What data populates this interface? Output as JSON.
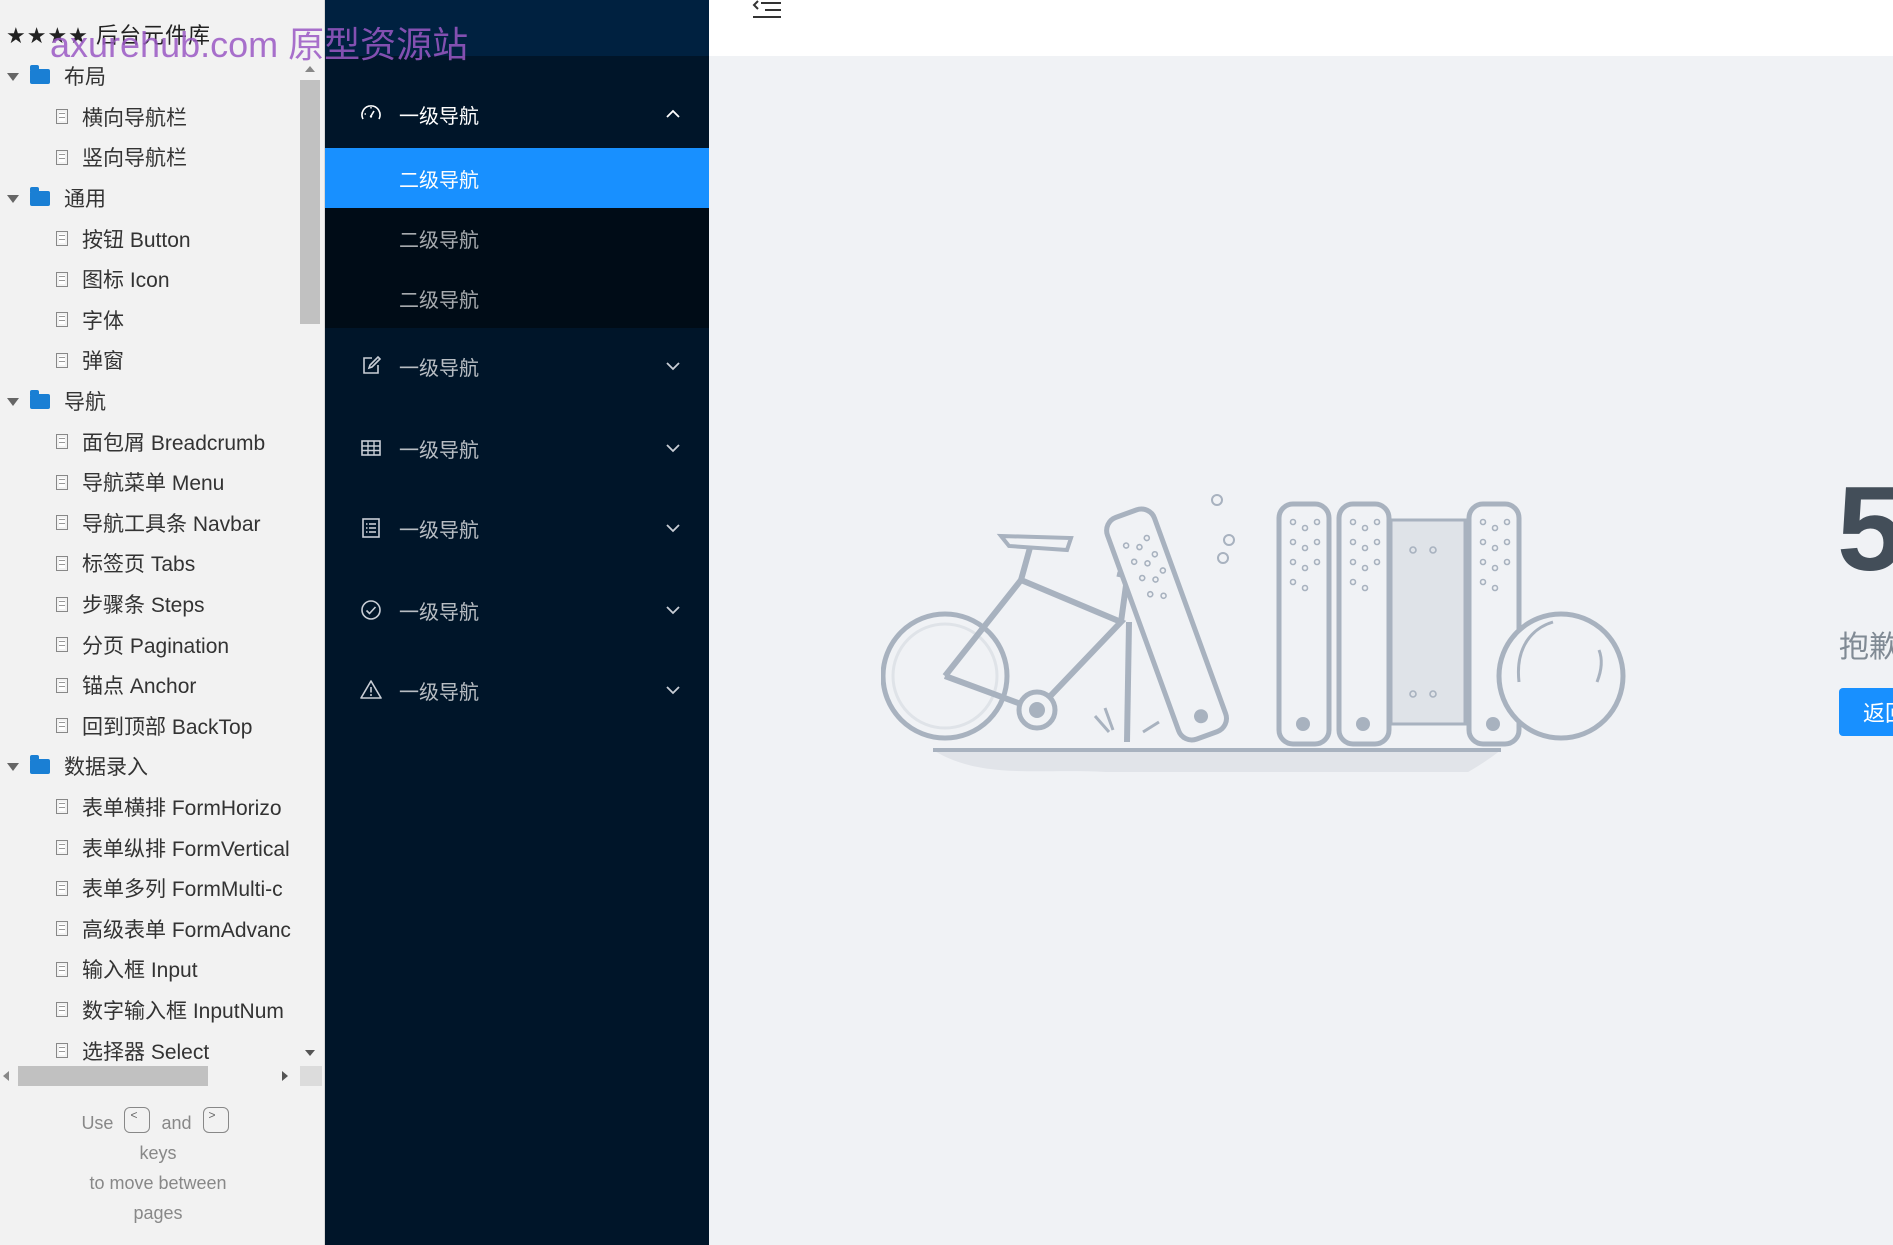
{
  "library": {
    "title": "★★★★ 后台元件库",
    "watermark": "axurehub.com 原型资源站",
    "tree": [
      {
        "type": "folder",
        "label": "布局"
      },
      {
        "type": "page",
        "label": "横向导航栏"
      },
      {
        "type": "page",
        "label": "竖向导航栏"
      },
      {
        "type": "folder",
        "label": "通用"
      },
      {
        "type": "page",
        "label": "按钮 Button"
      },
      {
        "type": "page",
        "label": "图标 Icon"
      },
      {
        "type": "page",
        "label": "字体"
      },
      {
        "type": "page",
        "label": "弹窗"
      },
      {
        "type": "folder",
        "label": "导航"
      },
      {
        "type": "page",
        "label": "面包屑 Breadcrumb"
      },
      {
        "type": "page",
        "label": "导航菜单 Menu"
      },
      {
        "type": "page",
        "label": "导航工具条 Navbar"
      },
      {
        "type": "page",
        "label": "标签页 Tabs"
      },
      {
        "type": "page",
        "label": "步骤条 Steps"
      },
      {
        "type": "page",
        "label": "分页 Pagination"
      },
      {
        "type": "page",
        "label": "锚点 Anchor"
      },
      {
        "type": "page",
        "label": "回到顶部 BackTop"
      },
      {
        "type": "folder",
        "label": "数据录入"
      },
      {
        "type": "page",
        "label": "表单横排 FormHorizo"
      },
      {
        "type": "page",
        "label": "表单纵排 FormVertical"
      },
      {
        "type": "page",
        "label": "表单多列 FormMulti-c"
      },
      {
        "type": "page",
        "label": "高级表单 FormAdvanc"
      },
      {
        "type": "page",
        "label": "输入框 Input"
      },
      {
        "type": "page",
        "label": "数字输入框 InputNum"
      },
      {
        "type": "page",
        "label": "选择器 Select"
      }
    ],
    "hint": {
      "use": "Use",
      "key_prev": "<",
      "and": "and",
      "key_next": ">",
      "keys": "keys",
      "line2": "to move between",
      "line3": "pages"
    }
  },
  "nav": {
    "colors": {
      "bg": "#001529",
      "sub_bg": "#000c17",
      "active": "#1890ff"
    },
    "groups": [
      {
        "label": "一级导航",
        "icon": "dashboard-icon",
        "expanded": true,
        "children": [
          "二级导航",
          "二级导航",
          "二级导航"
        ],
        "active_child": 0
      },
      {
        "label": "一级导航",
        "icon": "edit-icon",
        "expanded": false
      },
      {
        "label": "一级导航",
        "icon": "table-icon",
        "expanded": false
      },
      {
        "label": "一级导航",
        "icon": "profile-icon",
        "expanded": false
      },
      {
        "label": "一级导航",
        "icon": "check-circle-icon",
        "expanded": false
      },
      {
        "label": "一级导航",
        "icon": "warning-icon",
        "expanded": false
      }
    ]
  },
  "header": {
    "fold_icon": "menu-fold-icon"
  },
  "error_page": {
    "code": "5",
    "description": "抱歉",
    "button_label": "返回"
  }
}
